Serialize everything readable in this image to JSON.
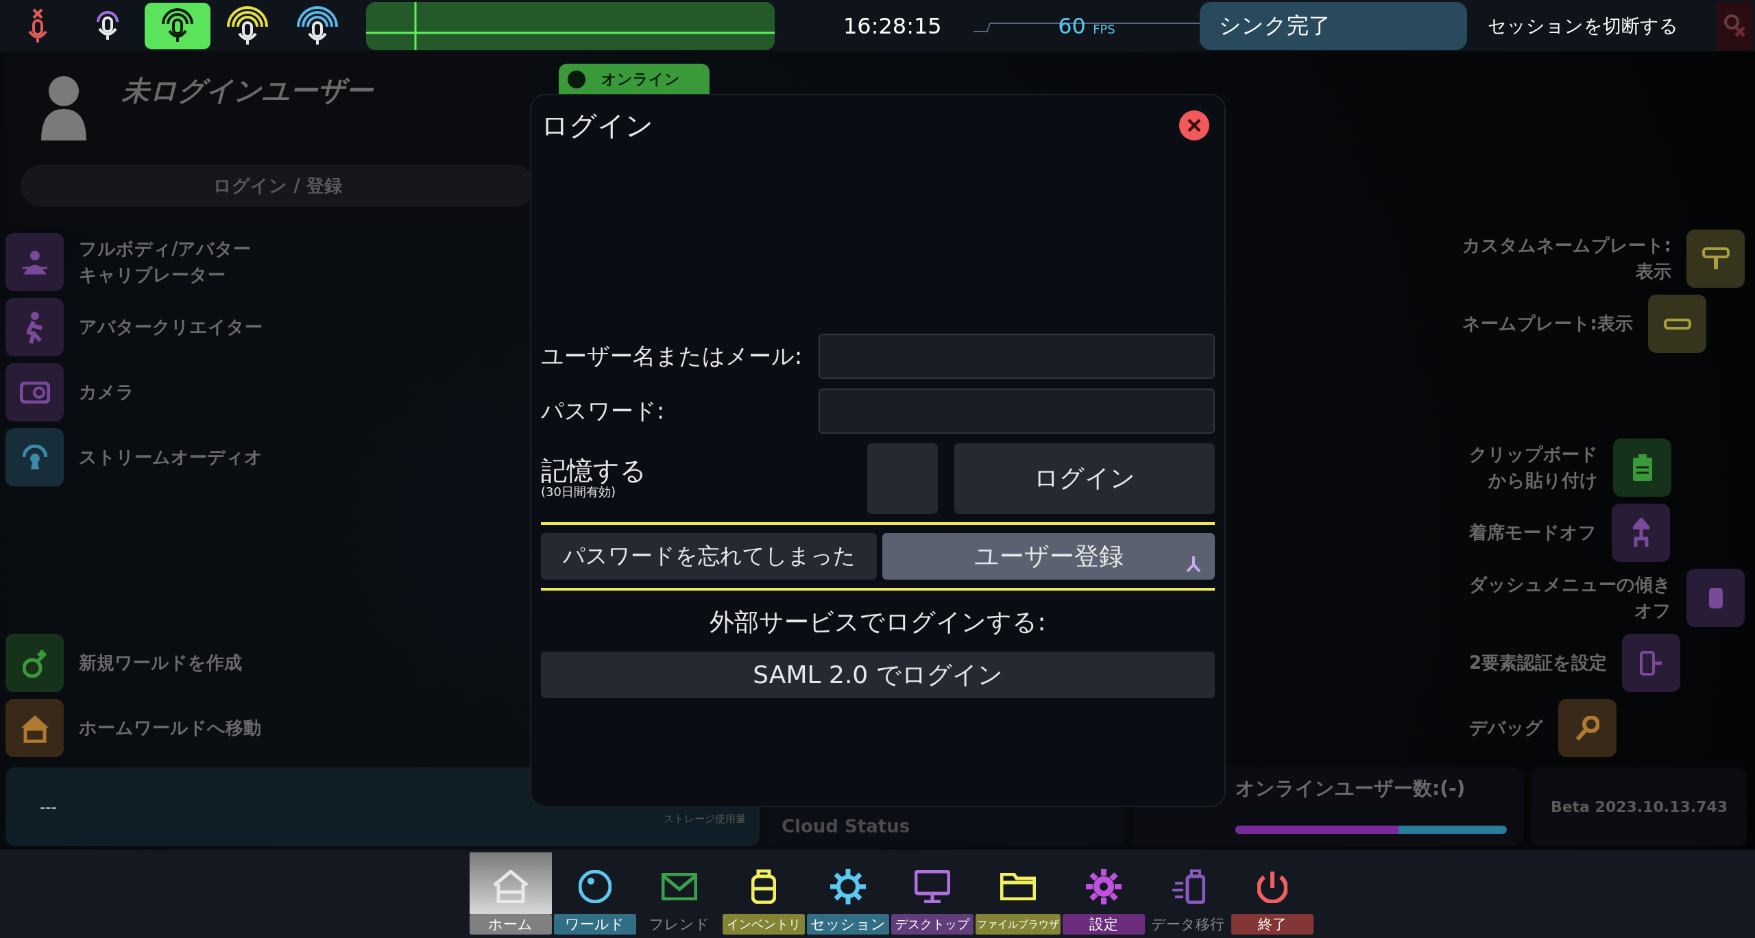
{
  "top_bar": {
    "voice_modes": [
      {
        "kind": "muted",
        "color": "#e05a5a",
        "selected": false
      },
      {
        "kind": "whisper",
        "color": "#a070e0",
        "selected": false
      },
      {
        "kind": "normal",
        "color": "#5ce35c",
        "selected": true
      },
      {
        "kind": "shout",
        "color": "#e8e040",
        "selected": false
      },
      {
        "kind": "broadcast",
        "color": "#5ab8e8",
        "selected": false
      }
    ],
    "clock": "16:28:15",
    "fps": "60",
    "fps_unit": "FPS",
    "sync_status": "シンク完了",
    "disconnect": "セッションを切断する"
  },
  "user": {
    "name": "未ログインユーザー",
    "login_button": "ログイン / 登録",
    "status": "オンライン"
  },
  "left_menu": {
    "top": [
      {
        "lines": [
          "フルボディ/アバター",
          "キャリブレーター"
        ],
        "color": "#7a4a9a"
      },
      {
        "lines": [
          "アバタークリエイター"
        ],
        "color": "#7a4a9a"
      },
      {
        "lines": [
          "カメラ"
        ],
        "color": "#7a4a9a"
      },
      {
        "lines": [
          "ストリームオーディオ"
        ],
        "color": "#3a8aa8"
      }
    ],
    "bottom": [
      {
        "lines": [
          "新規ワールドを作成"
        ],
        "color": "#3a9a3a"
      },
      {
        "lines": [
          "ホームワールドへ移動"
        ],
        "color": "#b07a30"
      }
    ]
  },
  "right_menu": {
    "top": [
      {
        "lines": [
          "カスタムネームプレート:",
          "表示"
        ],
        "color": "#a8a040"
      },
      {
        "lines": [
          "ネームプレート:表示"
        ],
        "color": "#a8a040"
      }
    ],
    "bottom": [
      {
        "lines": [
          "クリップボード",
          "から貼り付け"
        ],
        "color": "#3a9a3a"
      },
      {
        "lines": [
          "着席モードオフ"
        ],
        "color": "#7a4a9a"
      },
      {
        "lines": [
          "ダッシュメニューの傾き",
          "オフ"
        ],
        "color": "#7a4a9a"
      },
      {
        "lines": [
          "2要素認証を設定"
        ],
        "color": "#7a4a9a"
      },
      {
        "lines": [
          "デバッグ"
        ],
        "color": "#b07a30"
      }
    ]
  },
  "status_cards": {
    "storage_value": "---",
    "storage_label": "ストレージ使用量",
    "cloud_status": "Cloud Status",
    "online_users": "オンラインユーザー数:(-)",
    "online_bar": {
      "level": 0.6
    },
    "version": "Beta 2023.10.13.743"
  },
  "login_dialog": {
    "title": "ログイン",
    "username_label": "ユーザー名またはメール:",
    "password_label": "パスワード:",
    "remember_label": "記憶する",
    "remember_note": "(30日間有効)",
    "remember_checked": false,
    "login_button": "ログイン",
    "forgot_button": "パスワードを忘れてしまった",
    "register_button": "ユーザー登録",
    "external_heading": "外部サービスでログインする:",
    "saml_button": "SAML 2.0 でログイン"
  },
  "taskbar": [
    {
      "label": "ホーム",
      "color": "#e8e8e8",
      "labeled": true,
      "selected": true
    },
    {
      "label": "ワールド",
      "color": "#5bc8f0",
      "labeled": true,
      "selected": false
    },
    {
      "label": "フレンド",
      "color": "#3aa04a",
      "labeled": false,
      "selected": false
    },
    {
      "label": "インベントリ",
      "color": "#f0f060",
      "labeled": true,
      "selected": false
    },
    {
      "label": "セッション",
      "color": "#5bc8f0",
      "labeled": true,
      "selected": false
    },
    {
      "label": "デスクトップ",
      "color": "#b070e0",
      "labeled": true,
      "selected": false
    },
    {
      "label": "ファイルブラウザ",
      "color": "#f0f060",
      "labeled": true,
      "selected": false
    },
    {
      "label": "設定",
      "color": "#c050e0",
      "labeled": true,
      "selected": false
    },
    {
      "label": "データ移行",
      "color": "#8a5ac0",
      "labeled": false,
      "selected": false
    },
    {
      "label": "終了",
      "color": "#f06060",
      "labeled": true,
      "selected": false
    }
  ]
}
